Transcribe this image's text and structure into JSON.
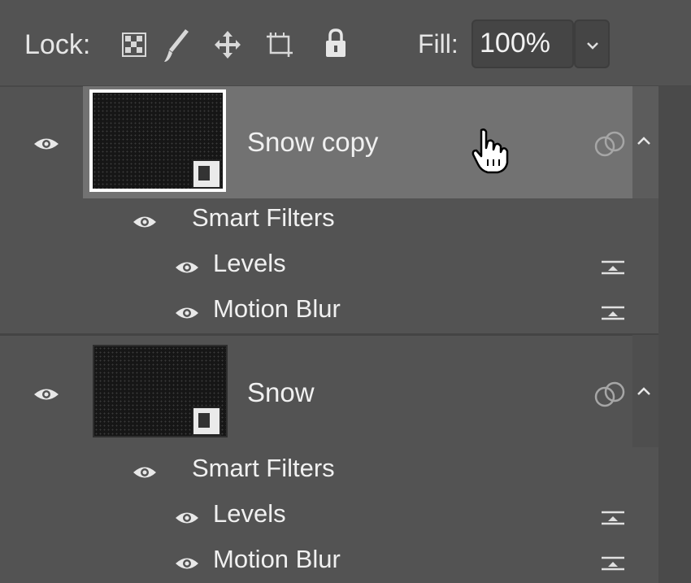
{
  "lockbar": {
    "lock_label": "Lock:",
    "fill_label": "Fill:",
    "fill_value": "100%"
  },
  "layers": [
    {
      "name": "Snow copy",
      "selected": true,
      "smart_filters_label": "Smart Filters",
      "filters": [
        "Levels",
        "Motion Blur"
      ]
    },
    {
      "name": "Snow",
      "selected": false,
      "smart_filters_label": "Smart Filters",
      "filters": [
        "Levels",
        "Motion Blur"
      ]
    }
  ],
  "colors": {
    "panel_bg": "#535353",
    "selected_row": "#727272",
    "text": "#f0f0f0"
  },
  "icons": [
    "transparency-lock-icon",
    "brush-lock-icon",
    "move-lock-icon",
    "artboard-lock-icon",
    "padlock-icon",
    "eye-icon",
    "linked-circles-icon",
    "chevron-up-icon",
    "chevron-down-icon",
    "filter-options-icon",
    "hand-cursor-icon",
    "smart-object-badge-icon"
  ]
}
